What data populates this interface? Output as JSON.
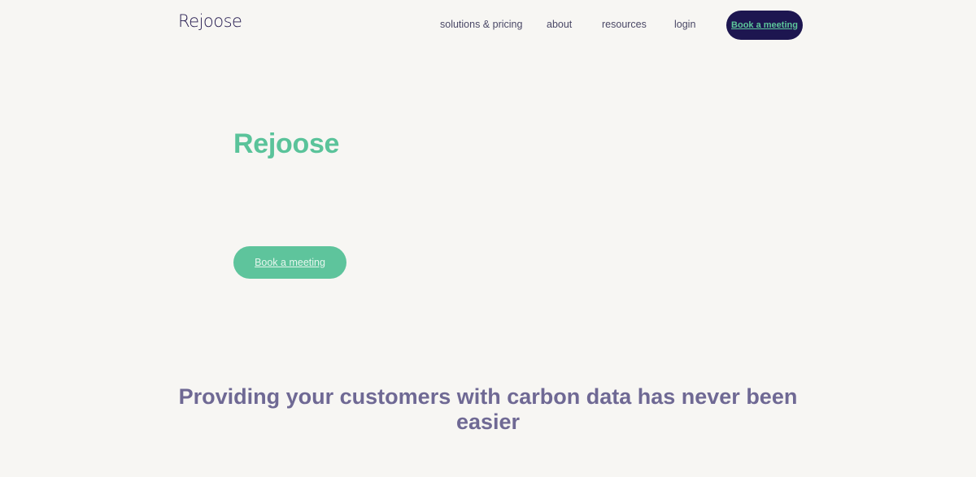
{
  "header": {
    "logo_text": "Rejoose",
    "nav": {
      "solutions": "solutions & pricing",
      "about": "about",
      "resources": "resources",
      "login": "login"
    },
    "cta_label": "Book a meeting"
  },
  "hero": {
    "title": "Rejoose",
    "cta_label": "Book a meeting"
  },
  "section": {
    "heading": "Providing your customers with carbon data has never been easier"
  },
  "colors": {
    "background": "#f7f6f3",
    "brand_dark": "#1d1650",
    "brand_green": "#5ec49c",
    "heading_purple": "#6f6994"
  }
}
